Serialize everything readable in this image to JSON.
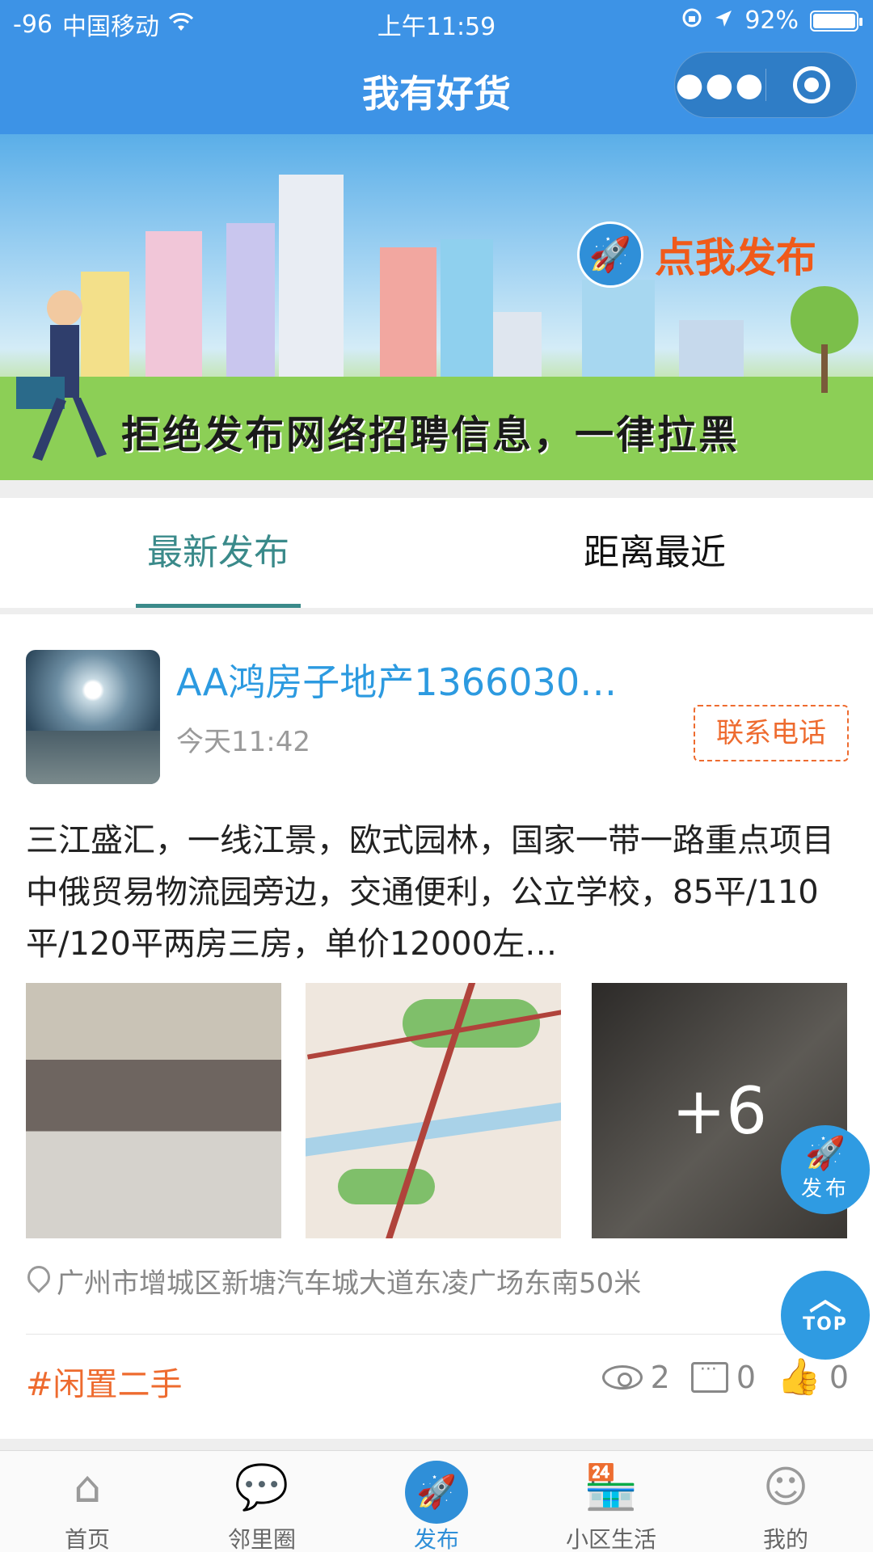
{
  "status_bar": {
    "signal": "-96",
    "carrier": "中国移动",
    "time": "上午11:59",
    "battery": "92%",
    "battery_level": 0.92
  },
  "nav": {
    "title": "我有好货",
    "more_icon": "more-dots-icon",
    "target_icon": "target-icon"
  },
  "banner": {
    "publish_label": "点我发布",
    "slogan": "拒绝发布网络招聘信息，一律拉黑"
  },
  "tabs": [
    {
      "label": "最新发布",
      "active": true
    },
    {
      "label": "距离最近",
      "active": false
    }
  ],
  "post": {
    "title": "AA鸿房子地产1366030…",
    "time": "今天11:42",
    "contact_label": "联系电话",
    "body": "三江盛汇，一线江景，欧式园林，国家一带一路重点项目中俄贸易物流园旁边，交通便利，公立学校，85平/110平/120平两房三房，单价12000左…",
    "more_photos": "+6",
    "location": "广州市增城区新塘汽车城大道东凌广场东南50米",
    "tag": "#闲置二手",
    "views": "2",
    "comments": "0",
    "likes": "0"
  },
  "fab": {
    "publish_label": "发布",
    "top_label": "TOP"
  },
  "tabbar": [
    {
      "label": "首页",
      "icon": "home-icon"
    },
    {
      "label": "邻里圈",
      "icon": "chat-bubbles-icon"
    },
    {
      "label": "发布",
      "icon": "rocket-icon",
      "active": true
    },
    {
      "label": "小区生活",
      "icon": "store-icon"
    },
    {
      "label": "我的",
      "icon": "smiley-icon"
    }
  ],
  "colors": {
    "brand_blue": "#3d93e6",
    "accent_orange": "#ee6b2f",
    "tab_active": "#3a8a8a",
    "title_blue": "#2c9ae0"
  }
}
